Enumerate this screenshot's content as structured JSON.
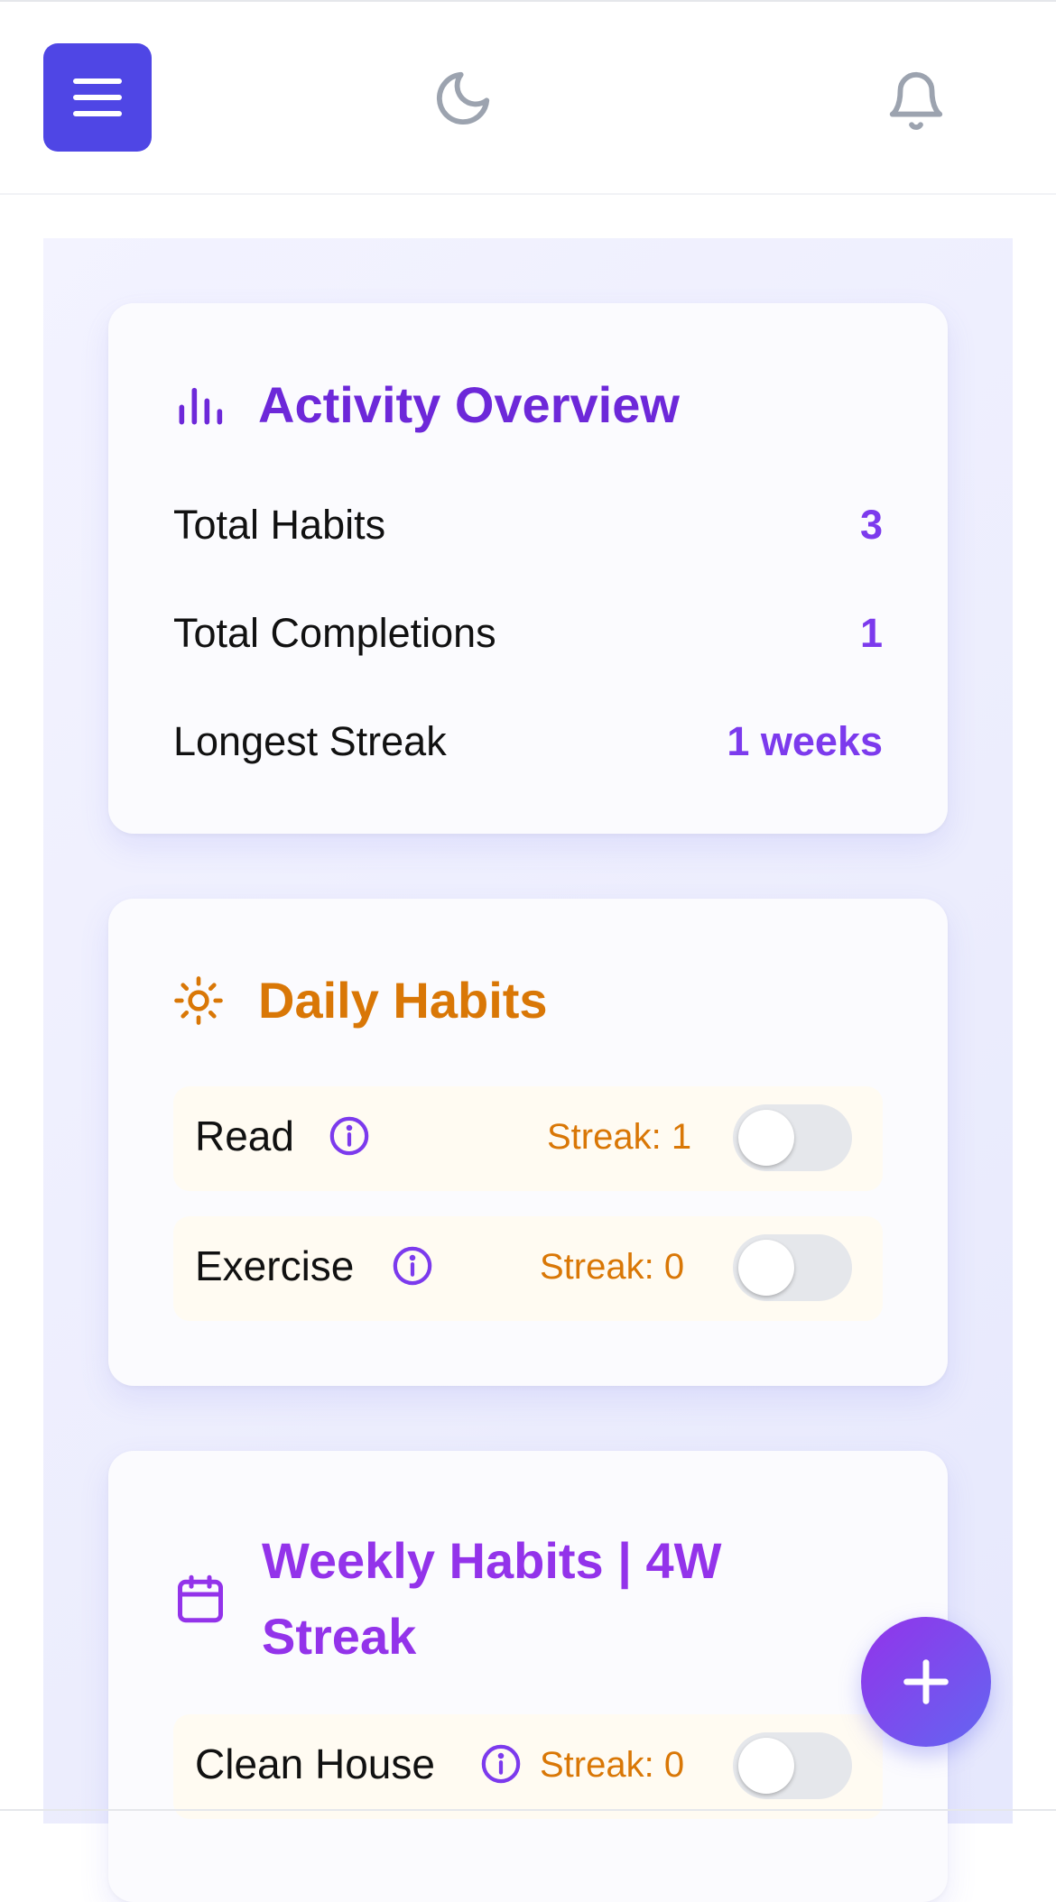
{
  "colors": {
    "primary": "#4f46e5",
    "accent_purple": "#7c3aed",
    "daily_orange": "#d97706",
    "weekly_purple": "#9333ea"
  },
  "header": {
    "menu_icon": "hamburger-icon",
    "theme_icon": "moon-icon",
    "notification_icon": "bell-icon"
  },
  "overview": {
    "icon": "bar-chart-icon",
    "title": "Activity Overview",
    "stats": [
      {
        "label": "Total Habits",
        "value": "3"
      },
      {
        "label": "Total Completions",
        "value": "1"
      },
      {
        "label": "Longest Streak",
        "value": "1 weeks"
      }
    ]
  },
  "daily": {
    "icon": "sun-icon",
    "title": "Daily Habits",
    "habits": [
      {
        "name": "Read",
        "streak": "Streak: 1",
        "done": false
      },
      {
        "name": "Exercise",
        "streak": "Streak: 0",
        "done": false
      }
    ]
  },
  "weekly": {
    "icon": "calendar-icon",
    "title_line1": "Weekly Habits | 4W",
    "title_line2": "Streak",
    "habits": [
      {
        "name": "Clean House",
        "streak": "Streak: 0",
        "done": false
      }
    ]
  },
  "fab": {
    "icon": "plus-icon"
  }
}
